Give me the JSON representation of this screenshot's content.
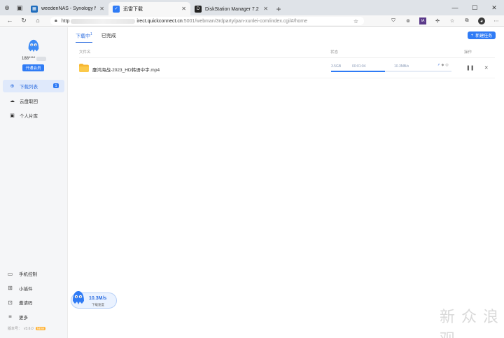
{
  "browser": {
    "tabs": [
      {
        "title": "weedenNAS - Synology NAS",
        "active": false,
        "color": "#1f6dbd"
      },
      {
        "title": "迅雷下载",
        "active": true,
        "color": "#2f7bf5"
      },
      {
        "title": "DiskStation Manager 7.2 | 群晖...",
        "active": false,
        "color": "#222222"
      }
    ],
    "url_prefix": "http",
    "url_host": "irect.quickconnect.cn",
    "url_path": ":5001/webman/3rdparty/pan-xunlei-com/index.cgi/#/home"
  },
  "sidebar": {
    "username": "188****",
    "vip_button": "开通会员",
    "menu": [
      {
        "label": "下载列表",
        "icon": "download-icon",
        "badge": "1",
        "active": true
      },
      {
        "label": "云盘取回",
        "icon": "cloud-icon",
        "active": false
      },
      {
        "label": "个人片库",
        "icon": "film-icon",
        "active": false
      }
    ],
    "bottom": [
      {
        "label": "手机控制",
        "icon": "phone-icon"
      },
      {
        "label": "小插件",
        "icon": "grid-icon"
      },
      {
        "label": "邀请码",
        "icon": "invite-icon"
      },
      {
        "label": "更多",
        "icon": "menu-icon"
      }
    ],
    "version_label": "版本号：",
    "version": "v3.6.0",
    "new_badge": "NEW"
  },
  "main": {
    "tabs": [
      {
        "label": "下载中",
        "count": "1",
        "active": true
      },
      {
        "label": "已完成",
        "count": "",
        "active": false
      }
    ],
    "new_task_button": "新建任务",
    "columns": {
      "name": "文件名",
      "status": "状态",
      "actions": "操作"
    },
    "rows": [
      {
        "name": "鏖鸿海战-2023_HD韩语中字.mp4",
        "size": "3.5GB",
        "time": "00:01:04",
        "speed": "10.3MB/s",
        "progress": 0.45
      }
    ]
  },
  "speed_widget": {
    "value": "10.3M/s",
    "label": "下载速度"
  },
  "watermark": "新 众 浪 观"
}
